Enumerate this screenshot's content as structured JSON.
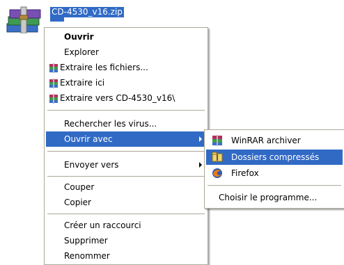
{
  "file": {
    "name": "CD-4530_v16.zip"
  },
  "menu": {
    "items": [
      {
        "label": "Ouvrir"
      },
      {
        "label": "Explorer"
      },
      {
        "label": "Extraire les fichiers..."
      },
      {
        "label": "Extraire ici"
      },
      {
        "label": "Extraire vers CD-4530_v16\\"
      },
      {
        "label": "Rechercher les virus..."
      },
      {
        "label": "Ouvrir avec"
      },
      {
        "label": "Envoyer vers"
      },
      {
        "label": "Couper"
      },
      {
        "label": "Copier"
      },
      {
        "label": "Créer un raccourci"
      },
      {
        "label": "Supprimer"
      },
      {
        "label": "Renommer"
      }
    ]
  },
  "submenu": {
    "items": [
      {
        "label": "WinRAR archiver"
      },
      {
        "label": "Dossiers compressés"
      },
      {
        "label": "Firefox"
      },
      {
        "label": "Choisir le programme..."
      }
    ]
  },
  "colors": {
    "highlight": "#316ac5",
    "separator": "#aca899"
  }
}
